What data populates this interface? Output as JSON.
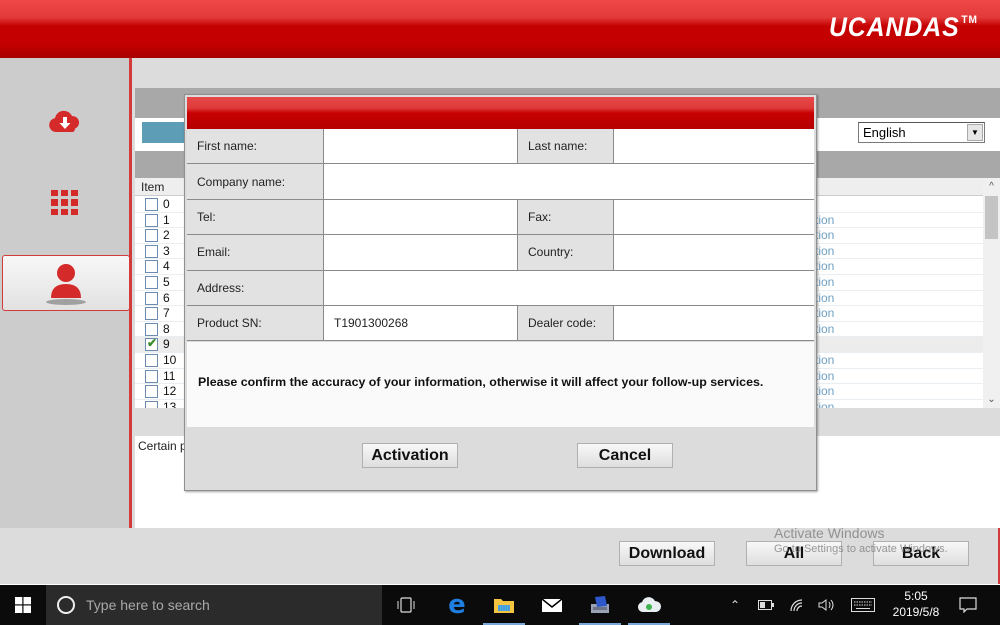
{
  "header": {
    "brand": "UCANDAS",
    "trademark": "TM"
  },
  "sidebar": {
    "items": [
      {
        "name": "download-cloud",
        "icon": "cloud-download-icon",
        "active": false
      },
      {
        "name": "apps-grid",
        "icon": "grid-icon",
        "active": false
      },
      {
        "name": "user",
        "icon": "user-icon",
        "active": true
      }
    ]
  },
  "toolbar": {
    "language": "English"
  },
  "list": {
    "column_header": "Item",
    "rows": [
      {
        "num": "0",
        "checked": false,
        "status": ""
      },
      {
        "num": "1",
        "checked": false,
        "status": "tion"
      },
      {
        "num": "2",
        "checked": false,
        "status": "tion"
      },
      {
        "num": "3",
        "checked": false,
        "status": "tion"
      },
      {
        "num": "4",
        "checked": false,
        "status": "tion"
      },
      {
        "num": "5",
        "checked": false,
        "status": "tion"
      },
      {
        "num": "6",
        "checked": false,
        "status": "tion"
      },
      {
        "num": "7",
        "checked": false,
        "status": "tion"
      },
      {
        "num": "8",
        "checked": false,
        "status": "tion"
      },
      {
        "num": "9",
        "checked": true,
        "status": ""
      },
      {
        "num": "10",
        "checked": false,
        "status": "tion"
      },
      {
        "num": "11",
        "checked": false,
        "status": "tion"
      },
      {
        "num": "12",
        "checked": false,
        "status": "tion"
      },
      {
        "num": "13",
        "checked": false,
        "status": "tion"
      }
    ]
  },
  "note": {
    "text": "Certain p"
  },
  "bottom": {
    "download": "Download",
    "all": "All",
    "back": "Back"
  },
  "watermark": {
    "line1": "Activate Windows",
    "line2": "Go to Settings to activate Windows."
  },
  "dialog": {
    "fields": {
      "first_name": {
        "label": "First name:",
        "value": ""
      },
      "last_name": {
        "label": "Last name:",
        "value": ""
      },
      "company_name": {
        "label": "Company name:",
        "value": ""
      },
      "tel": {
        "label": "Tel:",
        "value": ""
      },
      "fax": {
        "label": "Fax:",
        "value": ""
      },
      "email": {
        "label": "Email:",
        "value": ""
      },
      "country": {
        "label": "Country:",
        "value": ""
      },
      "address": {
        "label": "Address:",
        "value": ""
      },
      "product_sn": {
        "label": "Product SN:",
        "value": "T1901300268"
      },
      "dealer_code": {
        "label": "Dealer code:",
        "value": ""
      }
    },
    "message": "Please confirm the accuracy of your information, otherwise it will affect your follow-up services.",
    "activation": "Activation",
    "cancel": "Cancel"
  },
  "taskbar": {
    "search_placeholder": "Type here to search",
    "time": "5:05",
    "date": "2019/5/8"
  },
  "colors": {
    "brand_red": "#c40000",
    "accent_blue": "#5d9db6",
    "link_blue": "#6fa0c2"
  }
}
